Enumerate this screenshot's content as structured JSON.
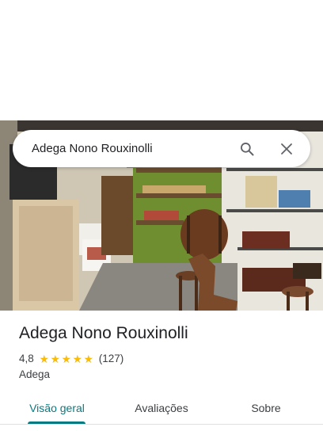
{
  "search": {
    "query": "Adega Nono Rouxinolli"
  },
  "place": {
    "name": "Adega Nono Rouxinolli",
    "rating": "4,8",
    "stars": 5,
    "review_count": "(127)",
    "category": "Adega"
  },
  "tabs": [
    {
      "label": "Visão geral",
      "active": true
    },
    {
      "label": "Avaliações",
      "active": false
    },
    {
      "label": "Sobre",
      "active": false
    }
  ],
  "icons": {
    "search": "search-icon",
    "close": "close-icon",
    "star": "star-icon"
  },
  "colors": {
    "accent": "#0b7a80",
    "star": "#fbbc04",
    "text": "#202124",
    "secondary_text": "#3c4043"
  }
}
